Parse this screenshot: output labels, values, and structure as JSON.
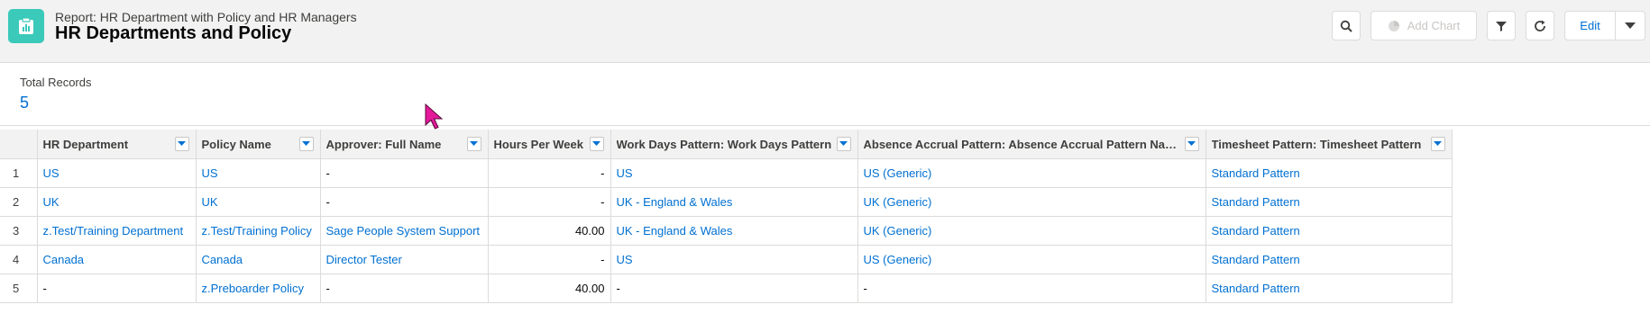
{
  "header": {
    "subtitle": "Report: HR Department with Policy and HR Managers",
    "title": "HR Departments and Policy",
    "icon": "report-icon",
    "icon_color": "#3bc9ba"
  },
  "toolbar": {
    "search_icon": "search-icon",
    "add_chart_label": "Add Chart",
    "filter_icon": "filter-icon",
    "refresh_icon": "refresh-icon",
    "edit_label": "Edit",
    "more_icon": "chevron-down-icon"
  },
  "summary": {
    "label": "Total Records",
    "value": "5"
  },
  "table": {
    "columns": [
      "HR Department",
      "Policy Name",
      "Approver: Full Name",
      "Hours Per Week",
      "Work Days Pattern: Work Days Pattern",
      "Absence Accrual Pattern: Absence Accrual Pattern Name",
      "Timesheet Pattern: Timesheet Pattern"
    ],
    "rows": [
      {
        "num": "1",
        "cells": [
          "US",
          "US",
          "-",
          "-",
          "US",
          "US (Generic)",
          "Standard Pattern"
        ]
      },
      {
        "num": "2",
        "cells": [
          "UK",
          "UK",
          "-",
          "-",
          "UK - England & Wales",
          "UK (Generic)",
          "Standard Pattern"
        ]
      },
      {
        "num": "3",
        "cells": [
          "z.Test/Training Department",
          "z.Test/Training Policy",
          "Sage People System Support",
          "40.00",
          "UK - England & Wales",
          "UK (Generic)",
          "Standard Pattern"
        ]
      },
      {
        "num": "4",
        "cells": [
          "Canada",
          "Canada",
          "Director Tester",
          "-",
          "US",
          "US (Generic)",
          "Standard Pattern"
        ]
      },
      {
        "num": "5",
        "cells": [
          "-",
          "z.Preboarder Policy",
          "-",
          "40.00",
          "-",
          "-",
          "Standard Pattern"
        ]
      }
    ]
  },
  "colors": {
    "link": "#0070d2",
    "header_bg": "#f3f2f2",
    "border": "#dddbda",
    "cursor": "#e4199b"
  }
}
